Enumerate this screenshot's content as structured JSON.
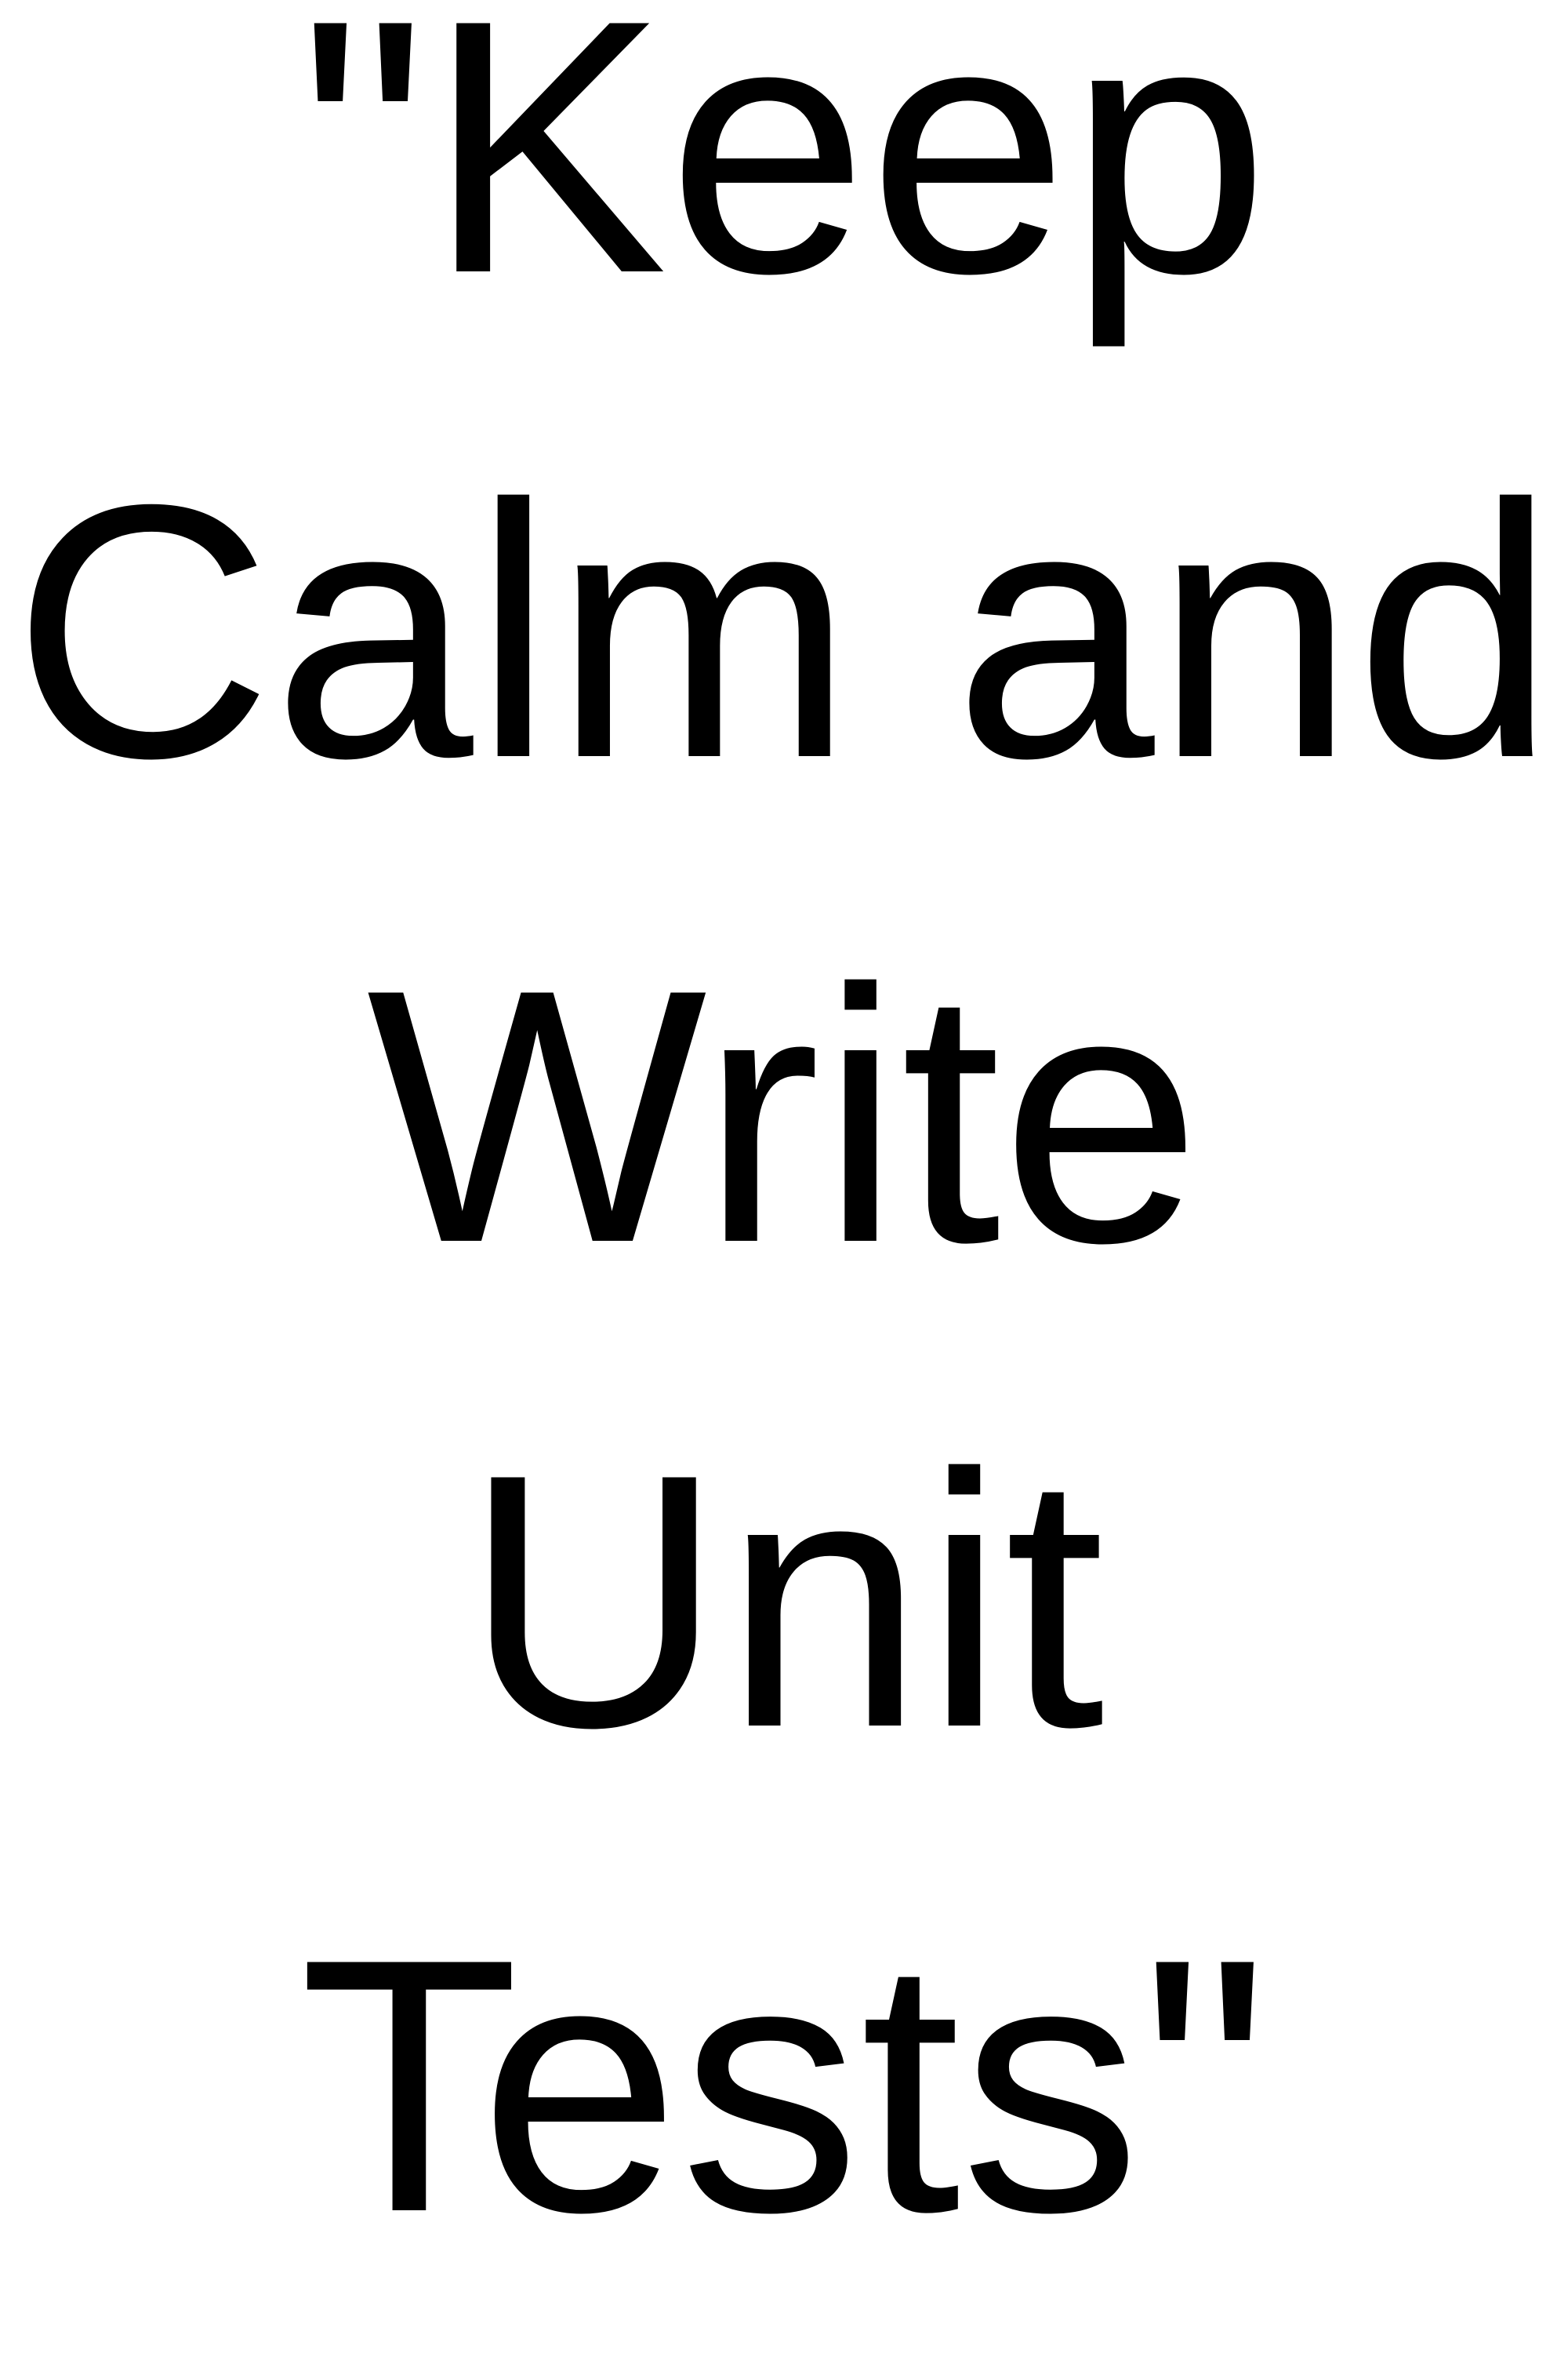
{
  "poster": {
    "lines": [
      "\"Keep",
      "Calm and",
      "Write",
      "Unit",
      "Tests\""
    ],
    "text_color": "#000000",
    "background_color": "#ffffff"
  }
}
